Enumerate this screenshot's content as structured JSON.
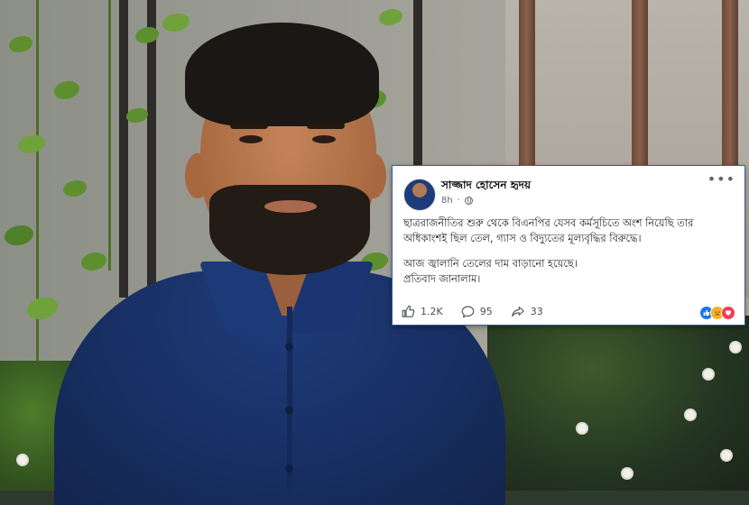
{
  "post": {
    "author_name": "সাজ্জাদ হোসেন হৃদয়",
    "time": "8h",
    "text_lines": [
      "ছাত্ররাজনীতির শুরু থেকে বিএনপির যেসব কর্মসূচিতে অংশ নিয়েছি তার",
      "অধিকাংশই ছিল তেল, গ্যাস ও বিদ্যুতের মূল্যবৃদ্ধির বিরুদ্ধে।",
      "আজ জ্বালানি তেলের দাম বাড়ানো হয়েছে।",
      "প্রতিবাদ জানালাম।"
    ],
    "likes": "1.2K",
    "comments": "95",
    "shares": "33",
    "more_label": "•••",
    "reaction_icons": [
      "like-reaction",
      "sad-reaction",
      "love-reaction"
    ]
  },
  "colors": {
    "like_blue": "#1877f2",
    "sad_yellow": "#f7b125",
    "love_red": "#f33e58",
    "card_border": "#3a5a9a"
  }
}
